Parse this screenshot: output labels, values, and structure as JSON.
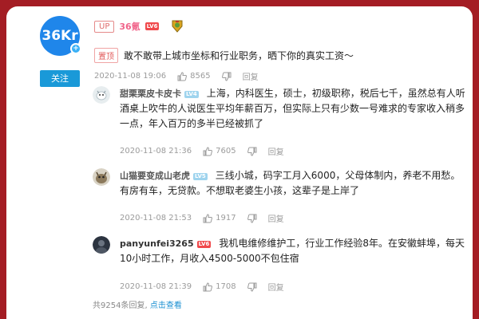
{
  "op": {
    "avatar_text": "36Kr",
    "follow_label": "关注",
    "up_tag": "UP",
    "name": "36氪",
    "level": "LV6",
    "pinned_tag": "置顶",
    "text": "敢不敢带上城市坐标和行业职务，晒下你的真实工资～",
    "time": "2020-11-08 19:06",
    "likes": "8565",
    "reply_label": "回复"
  },
  "replies": [
    {
      "name": "甜栗栗皮卡皮卡",
      "level": "LV4",
      "text": "上海，内科医生，硕士，初级职称，税后七千，虽然总有人听酒桌上吹牛的人说医生平均年薪百万，但实际上只有少数一号难求的专家收入稍多一点，年入百万的多半已经被抓了",
      "time": "2020-11-08 21:36",
      "likes": "7605",
      "reply_label": "回复"
    },
    {
      "name": "山猫要变成山老虎",
      "level": "LV5",
      "text": "三线小城，码字工月入6000，父母体制内，养老不用愁。有房有车，无贷款。不想取老婆生小孩，这辈子是上岸了",
      "time": "2020-11-08 21:53",
      "likes": "1917",
      "reply_label": "回复"
    },
    {
      "name": "panyunfei3265",
      "level": "LV6",
      "text": "我机电维修维护工，行业工作经验8年。在安徽蚌埠，每天10小时工作，月收入4500-5000不包住宿",
      "time": "2020-11-08 21:39",
      "likes": "1708",
      "reply_label": "回复"
    }
  ],
  "footer": {
    "count_text": "共9254条回复,",
    "view_link": "点击查看"
  },
  "colors": {
    "background": "#a41d24",
    "brand_blue": "#1f86ea",
    "link_blue": "#1a8fd1",
    "level_red": "#f0494c"
  }
}
